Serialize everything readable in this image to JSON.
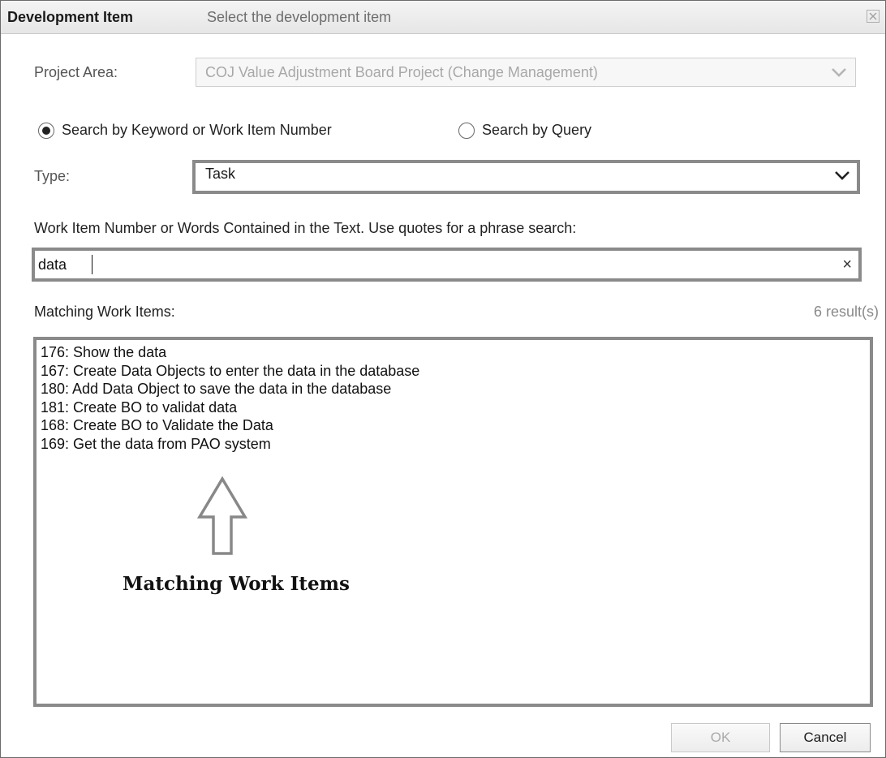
{
  "dialog": {
    "title": "Development Item",
    "subtitle": "Select the development item",
    "close_icon": "close-x-icon"
  },
  "project_area": {
    "label": "Project Area:",
    "value": "COJ Value Adjustment Board Project (Change Management)",
    "disabled": true
  },
  "search_mode": {
    "options": [
      {
        "label": "Search by Keyword or Work Item Number",
        "checked": true
      },
      {
        "label": "Search by Query",
        "checked": false
      }
    ]
  },
  "type": {
    "label": "Type:",
    "value": "Task"
  },
  "keyword": {
    "label": "Work Item Number or Words Contained in the Text. Use quotes for a phrase search:",
    "value": "data",
    "clear_icon": "×"
  },
  "results": {
    "label": "Matching Work Items:",
    "count": "6 result(s)",
    "items": [
      "176: Show the data",
      "167: Create Data Objects to enter the data in the database",
      "180: Add Data Object to save the data in the database",
      "181: Create BO to validat data",
      "168: Create BO to Validate the Data",
      "169: Get the data from PAO system"
    ]
  },
  "annotation": {
    "text": "Matching Work Items",
    "icon": "up-arrow-outline-icon"
  },
  "buttons": {
    "ok": "OK",
    "cancel": "Cancel",
    "ok_disabled": true
  }
}
